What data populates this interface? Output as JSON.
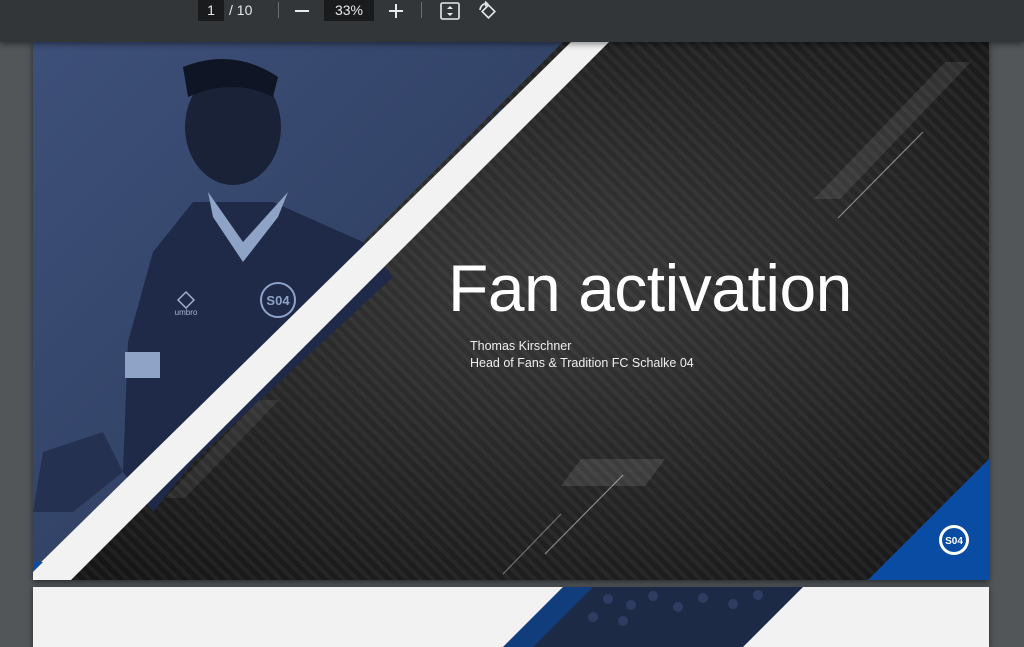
{
  "toolbar": {
    "current_page": "1",
    "total_pages": "/ 10",
    "zoom": "33%",
    "zoom_out_icon": "minus-icon",
    "zoom_in_icon": "plus-icon",
    "fit_icon": "fit-page-icon",
    "rotate_icon": "rotate-icon"
  },
  "slide": {
    "title": "Fan activation",
    "presenter": "Thomas Kirschner",
    "role": "Head of Fans & Tradition FC Schalke 04",
    "colors": {
      "blue": "#0a4ba3",
      "dark": "#232323",
      "photo_tint": "#3b4e78",
      "white_band": "#f2f2f2"
    }
  },
  "jersey": {
    "crest_text": "S04",
    "brand": "umbro"
  }
}
